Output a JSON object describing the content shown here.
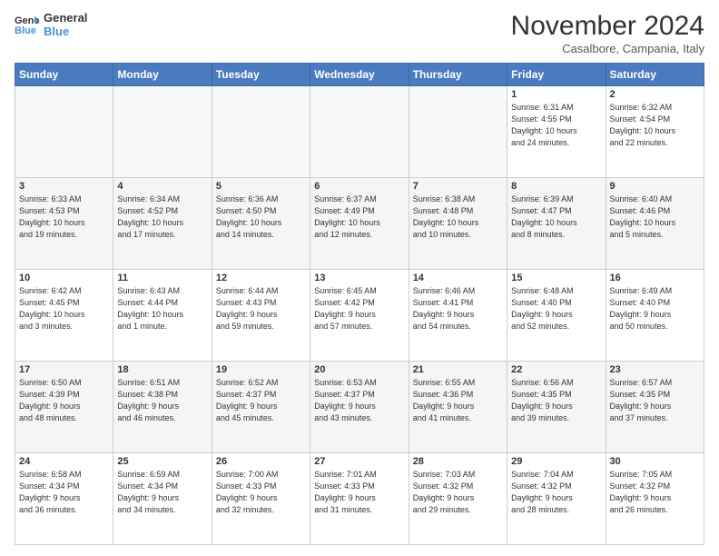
{
  "header": {
    "logo_general": "General",
    "logo_blue": "Blue",
    "month_title": "November 2024",
    "location": "Casalbore, Campania, Italy"
  },
  "weekdays": [
    "Sunday",
    "Monday",
    "Tuesday",
    "Wednesday",
    "Thursday",
    "Friday",
    "Saturday"
  ],
  "weeks": [
    [
      {
        "day": "",
        "info": ""
      },
      {
        "day": "",
        "info": ""
      },
      {
        "day": "",
        "info": ""
      },
      {
        "day": "",
        "info": ""
      },
      {
        "day": "",
        "info": ""
      },
      {
        "day": "1",
        "info": "Sunrise: 6:31 AM\nSunset: 4:55 PM\nDaylight: 10 hours\nand 24 minutes."
      },
      {
        "day": "2",
        "info": "Sunrise: 6:32 AM\nSunset: 4:54 PM\nDaylight: 10 hours\nand 22 minutes."
      }
    ],
    [
      {
        "day": "3",
        "info": "Sunrise: 6:33 AM\nSunset: 4:53 PM\nDaylight: 10 hours\nand 19 minutes."
      },
      {
        "day": "4",
        "info": "Sunrise: 6:34 AM\nSunset: 4:52 PM\nDaylight: 10 hours\nand 17 minutes."
      },
      {
        "day": "5",
        "info": "Sunrise: 6:36 AM\nSunset: 4:50 PM\nDaylight: 10 hours\nand 14 minutes."
      },
      {
        "day": "6",
        "info": "Sunrise: 6:37 AM\nSunset: 4:49 PM\nDaylight: 10 hours\nand 12 minutes."
      },
      {
        "day": "7",
        "info": "Sunrise: 6:38 AM\nSunset: 4:48 PM\nDaylight: 10 hours\nand 10 minutes."
      },
      {
        "day": "8",
        "info": "Sunrise: 6:39 AM\nSunset: 4:47 PM\nDaylight: 10 hours\nand 8 minutes."
      },
      {
        "day": "9",
        "info": "Sunrise: 6:40 AM\nSunset: 4:46 PM\nDaylight: 10 hours\nand 5 minutes."
      }
    ],
    [
      {
        "day": "10",
        "info": "Sunrise: 6:42 AM\nSunset: 4:45 PM\nDaylight: 10 hours\nand 3 minutes."
      },
      {
        "day": "11",
        "info": "Sunrise: 6:43 AM\nSunset: 4:44 PM\nDaylight: 10 hours\nand 1 minute."
      },
      {
        "day": "12",
        "info": "Sunrise: 6:44 AM\nSunset: 4:43 PM\nDaylight: 9 hours\nand 59 minutes."
      },
      {
        "day": "13",
        "info": "Sunrise: 6:45 AM\nSunset: 4:42 PM\nDaylight: 9 hours\nand 57 minutes."
      },
      {
        "day": "14",
        "info": "Sunrise: 6:46 AM\nSunset: 4:41 PM\nDaylight: 9 hours\nand 54 minutes."
      },
      {
        "day": "15",
        "info": "Sunrise: 6:48 AM\nSunset: 4:40 PM\nDaylight: 9 hours\nand 52 minutes."
      },
      {
        "day": "16",
        "info": "Sunrise: 6:49 AM\nSunset: 4:40 PM\nDaylight: 9 hours\nand 50 minutes."
      }
    ],
    [
      {
        "day": "17",
        "info": "Sunrise: 6:50 AM\nSunset: 4:39 PM\nDaylight: 9 hours\nand 48 minutes."
      },
      {
        "day": "18",
        "info": "Sunrise: 6:51 AM\nSunset: 4:38 PM\nDaylight: 9 hours\nand 46 minutes."
      },
      {
        "day": "19",
        "info": "Sunrise: 6:52 AM\nSunset: 4:37 PM\nDaylight: 9 hours\nand 45 minutes."
      },
      {
        "day": "20",
        "info": "Sunrise: 6:53 AM\nSunset: 4:37 PM\nDaylight: 9 hours\nand 43 minutes."
      },
      {
        "day": "21",
        "info": "Sunrise: 6:55 AM\nSunset: 4:36 PM\nDaylight: 9 hours\nand 41 minutes."
      },
      {
        "day": "22",
        "info": "Sunrise: 6:56 AM\nSunset: 4:35 PM\nDaylight: 9 hours\nand 39 minutes."
      },
      {
        "day": "23",
        "info": "Sunrise: 6:57 AM\nSunset: 4:35 PM\nDaylight: 9 hours\nand 37 minutes."
      }
    ],
    [
      {
        "day": "24",
        "info": "Sunrise: 6:58 AM\nSunset: 4:34 PM\nDaylight: 9 hours\nand 36 minutes."
      },
      {
        "day": "25",
        "info": "Sunrise: 6:59 AM\nSunset: 4:34 PM\nDaylight: 9 hours\nand 34 minutes."
      },
      {
        "day": "26",
        "info": "Sunrise: 7:00 AM\nSunset: 4:33 PM\nDaylight: 9 hours\nand 32 minutes."
      },
      {
        "day": "27",
        "info": "Sunrise: 7:01 AM\nSunset: 4:33 PM\nDaylight: 9 hours\nand 31 minutes."
      },
      {
        "day": "28",
        "info": "Sunrise: 7:03 AM\nSunset: 4:32 PM\nDaylight: 9 hours\nand 29 minutes."
      },
      {
        "day": "29",
        "info": "Sunrise: 7:04 AM\nSunset: 4:32 PM\nDaylight: 9 hours\nand 28 minutes."
      },
      {
        "day": "30",
        "info": "Sunrise: 7:05 AM\nSunset: 4:32 PM\nDaylight: 9 hours\nand 26 minutes."
      }
    ]
  ]
}
